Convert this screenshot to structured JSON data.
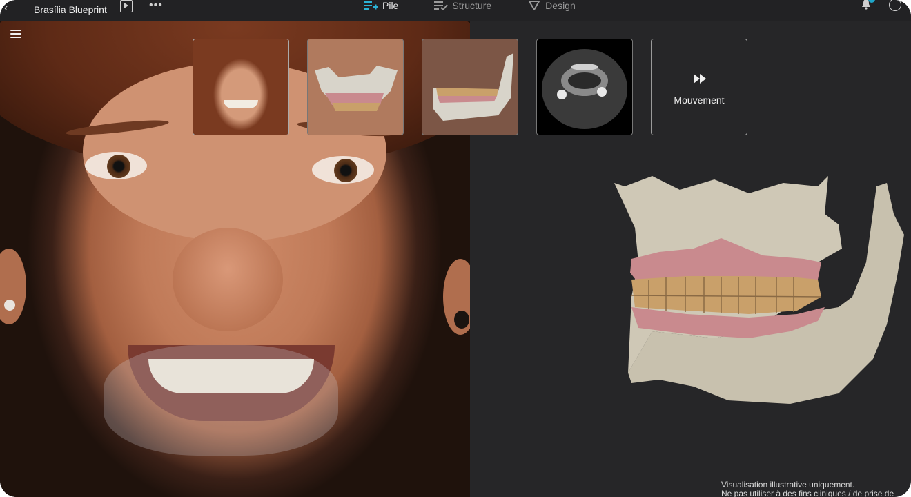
{
  "app": {
    "title": "Brasília Blueprint",
    "notification_count": "1"
  },
  "tabs": [
    {
      "label": "Pile",
      "icon": "add-list-icon",
      "active": true
    },
    {
      "label": "Structure",
      "icon": "checklist-icon",
      "active": false
    },
    {
      "label": "Design",
      "icon": "triangle-design-icon",
      "active": false
    }
  ],
  "thumbnails": [
    {
      "name": "portrait-photo",
      "label": ""
    },
    {
      "name": "maxilla-3d",
      "label": ""
    },
    {
      "name": "mandible-3d",
      "label": ""
    },
    {
      "name": "ct-scan",
      "label": ""
    },
    {
      "name": "movement",
      "label": "Mouvement",
      "icon": "fast-forward-icon"
    }
  ],
  "disclaimer": {
    "line1": "Visualisation illustrative uniquement.",
    "line2": "Ne pas utiliser à des fins cliniques / de prise de"
  },
  "colors": {
    "accent": "#1fa6c9",
    "background": "#262628",
    "topbar": "#222224",
    "gum": "#c98a8e",
    "bone": "#cfc8b6",
    "teeth": "#c9a06a"
  }
}
